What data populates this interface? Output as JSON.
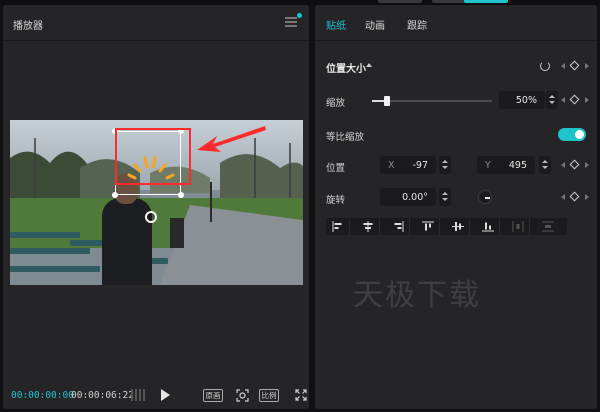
{
  "player": {
    "title": "播放器",
    "timecode_current": "00:00:00:00",
    "timecode_duration": "00:00:06:22",
    "btn_original": "原画",
    "btn_ratio": "比例"
  },
  "props": {
    "tabs": [
      "贴纸",
      "动画",
      "跟踪"
    ],
    "section_title": "位置大小",
    "scale_label": "缩放",
    "scale_value": "50%",
    "scale_level_percent": 50,
    "uniform_scale_label": "等比缩放",
    "position_label": "位置",
    "pos_x_prefix": "X",
    "pos_x_value": "-97",
    "pos_y_prefix": "Y",
    "pos_y_value": "495",
    "rotate_label": "旋转",
    "rotate_value": "0.00°"
  },
  "watermark": "天极下载",
  "colors": {
    "accent": "#1fc3cc",
    "panel": "#252527",
    "highlight_red": "#ff2a2a"
  }
}
